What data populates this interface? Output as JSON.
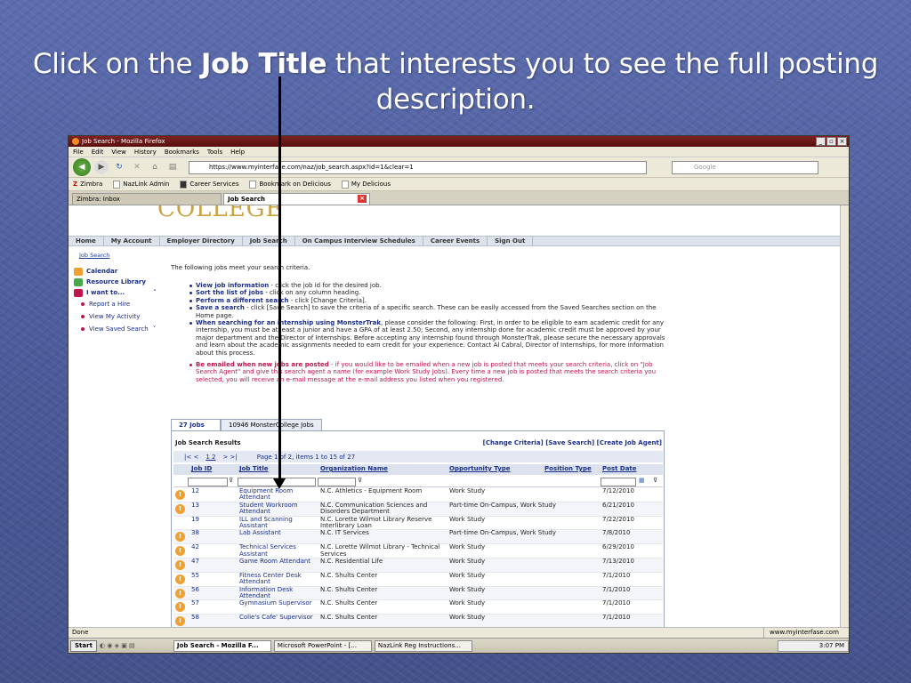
{
  "slide": {
    "title_pre": "Click on the ",
    "title_bold": "Job Title",
    "title_post": " that interests you to see the full posting description."
  },
  "browser": {
    "window_title": "Job Search - Mozilla Firefox",
    "menus": [
      "File",
      "Edit",
      "View",
      "History",
      "Bookmarks",
      "Tools",
      "Help"
    ],
    "url": "https://www.myinterfase.com/naz/job_search.aspx?id=1&clear=1",
    "search_placeholder": "Google",
    "bookmarks": [
      "Zimbra",
      "NazLink Admin",
      "Career Services",
      "Bookmark on Delicious",
      "My Delicious"
    ],
    "tabs": [
      "Zimbra: Inbox",
      "Job Search"
    ],
    "status_left": "Done",
    "status_right": "www.myinterfase.com"
  },
  "site": {
    "logo": "COLLEGE",
    "nav": [
      "Home",
      "My Account",
      "Employer Directory",
      "Job Search",
      "On Campus Interview Schedules",
      "Career Events",
      "Sign Out"
    ],
    "breadcrumb": "Job Search",
    "sidebar": {
      "main": [
        "Calendar",
        "Resource Library",
        "I want to..."
      ],
      "sub": [
        "Report a Hire",
        "View My Activity",
        "View Saved Search"
      ],
      "colors": {
        "calendar": "#f0a030",
        "resource": "#4aa84a",
        "iwant": "#c0154b"
      }
    },
    "intro": "The following jobs meet your search criteria.",
    "bullets": [
      {
        "b": "View job information",
        "t": " - click the job id for the desired job."
      },
      {
        "b": "Sort the list of jobs",
        "t": " - click on any column heading."
      },
      {
        "b": "Perform a different search",
        "t": " - click [Change Criteria]."
      },
      {
        "b": "Save a search",
        "t": " - click [Save Search] to save the criteria of a specific search. These can be easily accessed from the Saved Searches section on the Home page."
      },
      {
        "b": "When searching for an internship using MonsterTrak",
        "t": ", please consider the following: First, in order to be eligible to earn academic credit for any internship, you must be at least a junior and have a GPA of at least 2.50; Second, any internship done for academic credit must be approved by your major department and the Director of Internships. Before accepting any internship found through MonsterTrak, please secure the necessary approvals and learn about the academic assignments needed to earn credit for your experience. Contact Al Cabral, Director of Internships, for more information about this process."
      }
    ],
    "red_bullet": {
      "b": "Be emailed when new jobs are posted",
      "t": " - if you would like to be emailed when a new job is posted that meets your search criteria, click on \"Job Search Agent\" and give this search agent a name (for example Work Study Jobs). Every time a new job is posted that meets the search criteria you selected, you will receive an e-mail message at the e-mail address you listed when you registered."
    },
    "result_tabs": [
      "27 Jobs",
      "10946 MonsterCollege Jobs"
    ],
    "results_title": "Job Search Results",
    "results_links": "[Change Criteria] [Save Search] [Create Job Agent]",
    "pager": {
      "prev": "|< <",
      "pages": "1  2",
      "next": "> >|",
      "info": "Page 1 of 2, items 1 to 15 of 27"
    },
    "columns": [
      "Job ID",
      "Job Title",
      "Organization Name",
      "Opportunity Type",
      "Position Type",
      "Post Date"
    ],
    "rows": [
      {
        "id": "12",
        "title": "Equipment Room Attendant",
        "org": "N.C. Athletics - Equipment Room",
        "type": "Work Study",
        "date": "7/12/2010",
        "icon": true
      },
      {
        "id": "13",
        "title": "Student Workroom Attendant",
        "org": "N.C. Communication Sciences and Disorders Department",
        "type": "Part-time On-Campus, Work Study",
        "date": "6/21/2010",
        "icon": true
      },
      {
        "id": "19",
        "title": "ILL and Scanning Assistant",
        "org": "N.C. Lorette Wilmot Library Reserve Interlibrary Loan",
        "type": "Work Study",
        "date": "7/22/2010",
        "icon": false
      },
      {
        "id": "38",
        "title": "Lab Assistant",
        "org": "N.C. IT Services",
        "type": "Part-time On-Campus, Work Study",
        "date": "7/8/2010",
        "icon": true
      },
      {
        "id": "42",
        "title": "Technical Services Assistant",
        "org": "N.C. Lorette Wilmot Library - Technical Services",
        "type": "Work Study",
        "date": "6/29/2010",
        "icon": true
      },
      {
        "id": "47",
        "title": "Game Room Attendant",
        "org": "N.C. Residential Life",
        "type": "Work Study",
        "date": "7/13/2010",
        "icon": true
      },
      {
        "id": "55",
        "title": "Fitness Center Desk Attendant",
        "org": "N.C. Shults Center",
        "type": "Work Study",
        "date": "7/1/2010",
        "icon": true
      },
      {
        "id": "56",
        "title": "Information Desk Attendant",
        "org": "N.C. Shults Center",
        "type": "Work Study",
        "date": "7/1/2010",
        "icon": true
      },
      {
        "id": "57",
        "title": "Gymnasium Supervisor",
        "org": "N.C. Shults Center",
        "type": "Work Study",
        "date": "7/1/2010",
        "icon": true
      },
      {
        "id": "58",
        "title": "Colie's Cafe' Supervisor",
        "org": "N.C. Shults Center",
        "type": "Work Study",
        "date": "7/1/2010",
        "icon": true
      }
    ]
  },
  "taskbar": {
    "start": "Start",
    "tasks": [
      "Job Search - Mozilla F...",
      "Microsoft PowerPoint - [...",
      "NazLink Reg Instructions..."
    ],
    "clock": "3:07 PM"
  }
}
